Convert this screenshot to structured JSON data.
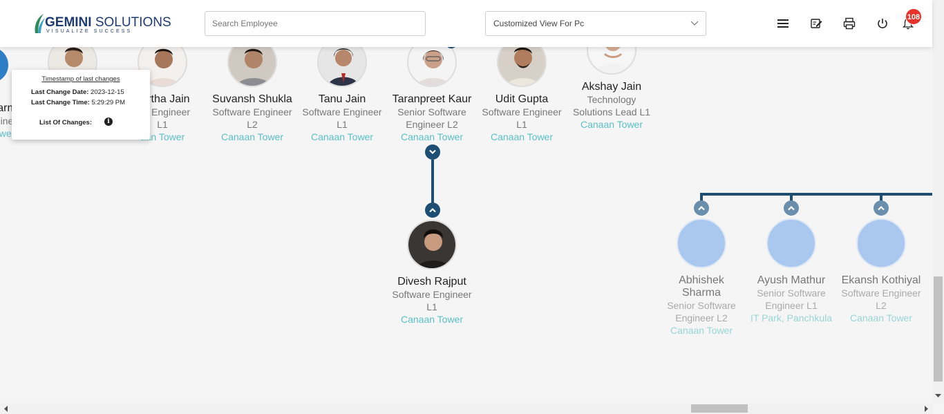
{
  "header": {
    "logo": {
      "brand_bold": "GEMINI",
      "brand_rest": " SOLUTIONS",
      "tagline": "VISUALIZE SUCCESS"
    },
    "search": {
      "placeholder": "Search Employee"
    },
    "view_select": {
      "value": "Customized View For Pc"
    },
    "notifications": {
      "count": "108"
    },
    "icons": [
      "menu-icon",
      "edit-note-icon",
      "print-icon",
      "power-icon",
      "bell-icon"
    ]
  },
  "tooltip": {
    "heading": "Timestamp of last changes",
    "date_label": "Last Change Date:",
    "date_value": "2023-12-15",
    "time_label": "Last Change Time:",
    "time_value": "5:29:29 PM",
    "changes_label": "List Of Changes:"
  },
  "top_row": [
    {
      "name": "arm",
      "title": "ine",
      "level": "",
      "location": "wer"
    },
    {
      "name": "",
      "title": "",
      "level": "",
      "location": ""
    },
    {
      "name": "hartha Jain",
      "title": "are Engineer",
      "level": "L1",
      "location": "aan Tower"
    },
    {
      "name": "Suvansh Shukla",
      "title": "Software Engineer",
      "level": "L2",
      "location": "Canaan Tower"
    },
    {
      "name": "Tanu Jain",
      "title": "Software Engineer",
      "level": "L1",
      "location": "Canaan Tower"
    },
    {
      "name": "Taranpreet Kaur",
      "title": "Senior Software",
      "level": "Engineer L2",
      "location": "Canaan Tower"
    },
    {
      "name": "Udit Gupta",
      "title": "Software Engineer",
      "level": "L1",
      "location": "Canaan Tower"
    },
    {
      "name": "Akshay Jain",
      "title": "Technology",
      "level": "Solutions Lead L1",
      "location": "Canaan Tower"
    }
  ],
  "child": {
    "name": "Divesh Rajput",
    "title": "Software Engineer",
    "level": "L1",
    "location": "Canaan Tower"
  },
  "right_group": [
    {
      "name": "Abhishek",
      "name2": "Sharma",
      "title": "Senior Software",
      "level": "Engineer L2",
      "location": "Canaan Tower"
    },
    {
      "name": "Ayush Mathur",
      "name2": "",
      "title": "Senior Software",
      "level": "Engineer L1",
      "location": "IT Park, Panchkula"
    },
    {
      "name": "Ekansh Kothiyal",
      "name2": "",
      "title": "Software Engineer",
      "level": "L2",
      "location": "Canaan Tower"
    }
  ],
  "colors": {
    "connector": "#1f4e74",
    "location": "#5bc0c7",
    "badge": "#e8332a",
    "placeholder_avatar": "#a9c7ef"
  }
}
